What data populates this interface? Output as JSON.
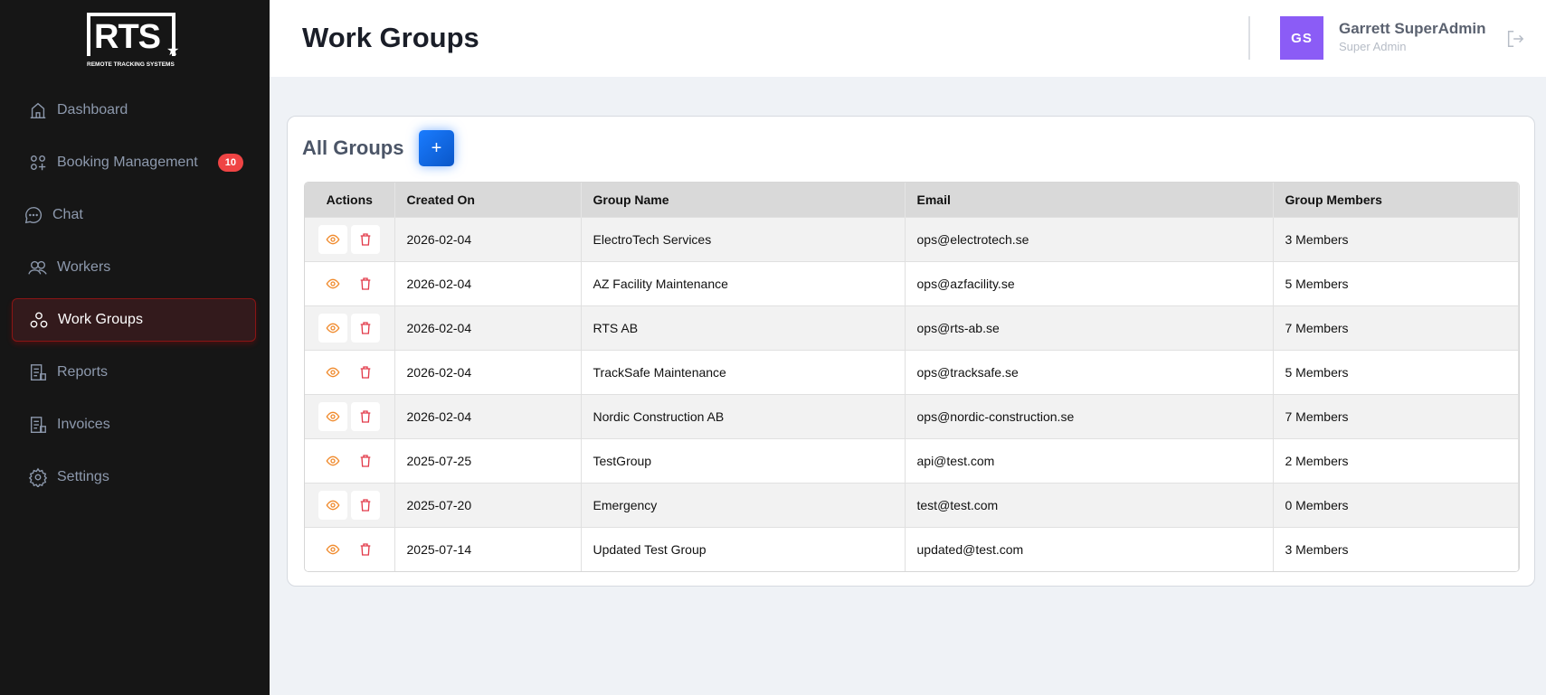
{
  "brand": {
    "logo_text": "RTS",
    "logo_sub": "REMOTE TRACKING SYSTEMS"
  },
  "sidebar": {
    "items": [
      {
        "label": "Dashboard",
        "icon": "home-icon"
      },
      {
        "label": "Booking Management",
        "icon": "grid-plus-icon",
        "badge": "10"
      },
      {
        "label": "Chat",
        "icon": "chat-icon"
      },
      {
        "label": "Workers",
        "icon": "users-icon"
      },
      {
        "label": "Work Groups",
        "icon": "groups-icon",
        "active": true
      },
      {
        "label": "Reports",
        "icon": "report-icon"
      },
      {
        "label": "Invoices",
        "icon": "invoice-icon"
      },
      {
        "label": "Settings",
        "icon": "gear-icon"
      }
    ]
  },
  "header": {
    "title": "Work Groups",
    "user": {
      "initials": "GS",
      "name": "Garrett SuperAdmin",
      "role": "Super Admin"
    }
  },
  "card": {
    "title": "All Groups",
    "add_label": "+"
  },
  "table": {
    "columns": [
      "Actions",
      "Created On",
      "Group Name",
      "Email",
      "Group Members"
    ],
    "rows": [
      {
        "created": "2026-02-04",
        "name": "ElectroTech Services",
        "email": "ops@electrotech.se",
        "members": "3 Members"
      },
      {
        "created": "2026-02-04",
        "name": "AZ Facility Maintenance",
        "email": "ops@azfacility.se",
        "members": "5 Members"
      },
      {
        "created": "2026-02-04",
        "name": "RTS AB",
        "email": "ops@rts-ab.se",
        "members": "7 Members"
      },
      {
        "created": "2026-02-04",
        "name": "TrackSafe Maintenance",
        "email": "ops@tracksafe.se",
        "members": "5 Members"
      },
      {
        "created": "2026-02-04",
        "name": "Nordic Construction AB",
        "email": "ops@nordic-construction.se",
        "members": "7 Members"
      },
      {
        "created": "2025-07-25",
        "name": "TestGroup",
        "email": "api@test.com",
        "members": "2 Members"
      },
      {
        "created": "2025-07-20",
        "name": "Emergency",
        "email": "test@test.com",
        "members": "0 Members"
      },
      {
        "created": "2025-07-14",
        "name": "Updated Test Group",
        "email": "updated@test.com",
        "members": "3 Members"
      }
    ]
  },
  "colors": {
    "accent": "#0a6cf0",
    "active_border": "#8a1515",
    "avatar": "#8b5cf6",
    "view_icon": "#f08a2c",
    "delete_icon": "#e23b4a",
    "badge": "#ef4444"
  }
}
